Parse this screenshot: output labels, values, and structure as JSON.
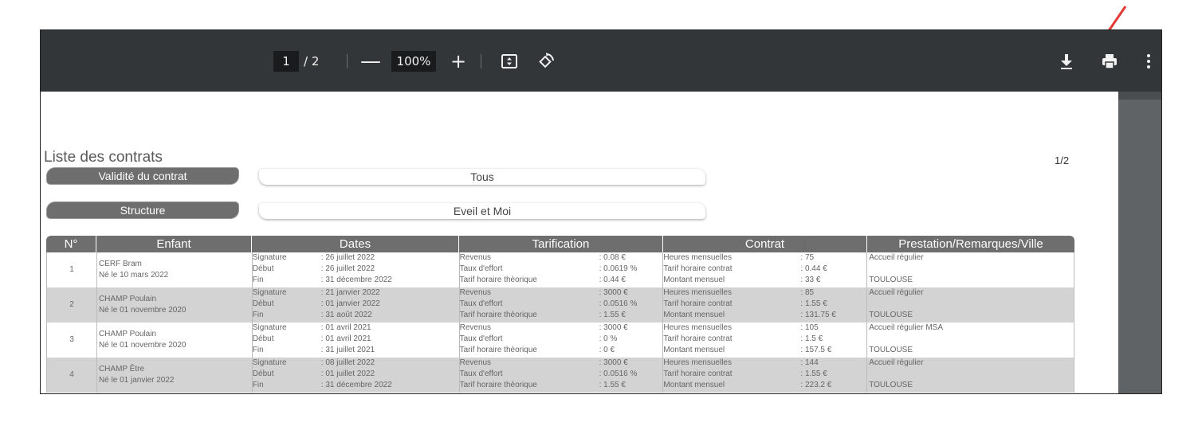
{
  "toolbar": {
    "page_current": "1",
    "page_total": "/ 2",
    "zoom_out": "—",
    "zoom_level": "100%",
    "zoom_in": "+",
    "icons": [
      "fit-page-icon",
      "rotate-icon",
      "download-icon",
      "print-icon",
      "more-vert-icon"
    ]
  },
  "annotation": {
    "arrow_color": "#e53935"
  },
  "document": {
    "title": "Liste des contrats",
    "page_indicator": "1/2",
    "filters": [
      {
        "label": "Validité du contrat",
        "value": "Tous"
      },
      {
        "label": "Structure",
        "value": "Eveil et Moi"
      }
    ],
    "table": {
      "headers": [
        "N°",
        "Enfant",
        "Dates",
        "Tarification",
        "Contrat",
        "Prestation/Remarques/Ville"
      ],
      "rows": [
        {
          "n": "1",
          "name": "CERF Bram",
          "born": "Né le 10 mars 2022",
          "dates": [
            [
              "Signature",
              ": 26 juillet 2022"
            ],
            [
              "Début",
              ": 26 juillet 2022"
            ],
            [
              "Fin",
              ": 31 décembre 2022"
            ]
          ],
          "tarif": [
            [
              "Revenus",
              ": 0.08 €"
            ],
            [
              "Taux d'effort",
              ": 0.0619 %"
            ],
            [
              "Tarif horaire thèorique",
              ": 0.44 €"
            ]
          ],
          "contrat": [
            [
              "Heures mensuelles",
              ": 75"
            ],
            [
              "Tarif horaire contrat",
              ": 0.44 €"
            ],
            [
              "Montant mensuel",
              ": 33 €"
            ]
          ],
          "prestation": "Accueil régulier",
          "ville": "TOULOUSE"
        },
        {
          "n": "2",
          "name": "CHAMP Poulain",
          "born": "Né le 01 novembre 2020",
          "dates": [
            [
              "Signature",
              ": 21 janvier 2022"
            ],
            [
              "Début",
              ": 01 janvier 2022"
            ],
            [
              "Fin",
              ": 31 août 2022"
            ]
          ],
          "tarif": [
            [
              "Revenus",
              ": 3000 €"
            ],
            [
              "Taux d'effort",
              ": 0.0516 %"
            ],
            [
              "Tarif horaire thèorique",
              ": 1.55 €"
            ]
          ],
          "contrat": [
            [
              "Heures mensuelles",
              ": 85"
            ],
            [
              "Tarif horaire contrat",
              ": 1.55 €"
            ],
            [
              "Montant mensuel",
              ": 131.75 €"
            ]
          ],
          "prestation": "Accueil régulier",
          "ville": "TOULOUSE"
        },
        {
          "n": "3",
          "name": "CHAMP Poulain",
          "born": "Né le 01 novembre 2020",
          "dates": [
            [
              "Signature",
              ": 01 avril 2021"
            ],
            [
              "Début",
              ": 01 avril 2021"
            ],
            [
              "Fin",
              ": 31 juillet 2021"
            ]
          ],
          "tarif": [
            [
              "Revenus",
              ": 3000 €"
            ],
            [
              "Taux d'effort",
              ": 0 %"
            ],
            [
              "Tarif horaire thèorique",
              ": 0 €"
            ]
          ],
          "contrat": [
            [
              "Heures mensuelles",
              ": 105"
            ],
            [
              "Tarif horaire contrat",
              ": 1.5 €"
            ],
            [
              "Montant mensuel",
              ": 157.5 €"
            ]
          ],
          "prestation": "Accueil régulier MSA",
          "ville": "TOULOUSE"
        },
        {
          "n": "4",
          "name": "CHAMP Être",
          "born": "Né le 01 janvier 2022",
          "dates": [
            [
              "Signature",
              ": 08 juillet 2022"
            ],
            [
              "Début",
              ": 01 juillet 2022"
            ],
            [
              "Fin",
              ": 31 décembre 2022"
            ]
          ],
          "tarif": [
            [
              "Revenus",
              ": 3000 €"
            ],
            [
              "Taux d'effort",
              ": 0.0516 %"
            ],
            [
              "Tarif horaire thèorique",
              ": 1.55 €"
            ]
          ],
          "contrat": [
            [
              "Heures mensuelles",
              ": 144"
            ],
            [
              "Tarif horaire contrat",
              ": 1.55 €"
            ],
            [
              "Montant mensuel",
              ": 223.2 €"
            ]
          ],
          "prestation": "Accueil régulier",
          "ville": "TOULOUSE"
        }
      ]
    }
  }
}
